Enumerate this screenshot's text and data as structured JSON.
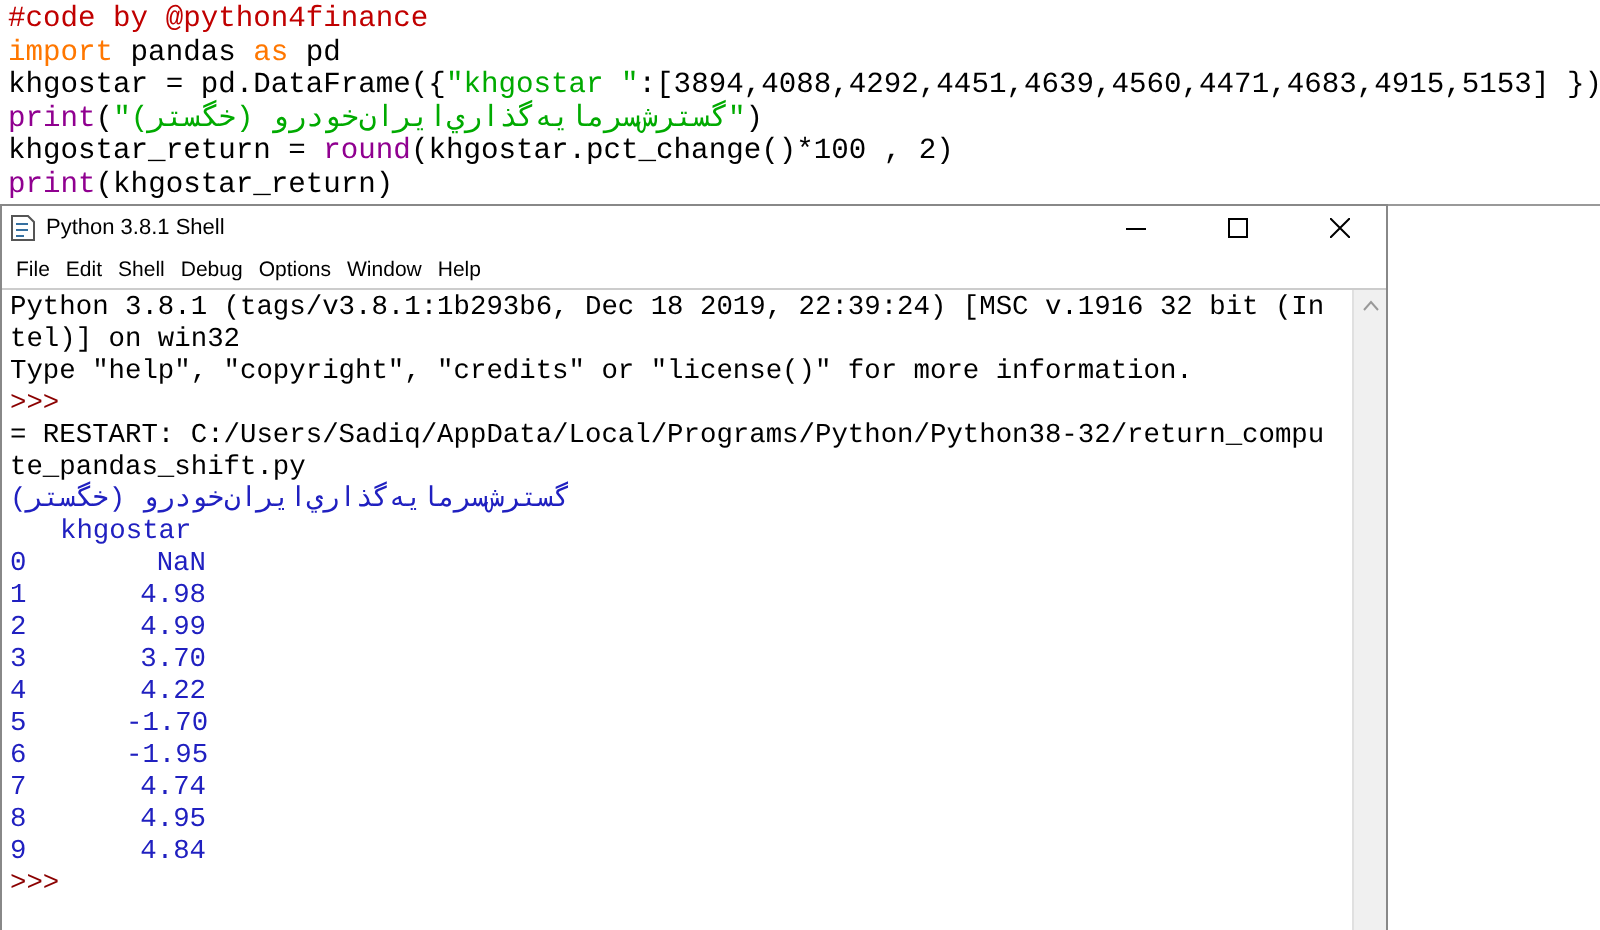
{
  "editor": {
    "lines": [
      [
        {
          "kind": "comment",
          "text": "#code by @python4finance"
        }
      ],
      [
        {
          "kind": "keyword",
          "text": "import"
        },
        {
          "kind": "plain",
          "text": " pandas "
        },
        {
          "kind": "keyword",
          "text": "as"
        },
        {
          "kind": "plain",
          "text": " pd"
        }
      ],
      [
        {
          "kind": "plain",
          "text": "khgostar = pd.DataFrame({"
        },
        {
          "kind": "string",
          "text": "\"khgostar \""
        },
        {
          "kind": "plain",
          "text": ":[3894,4088,4292,4451,4639,4560,4471,4683,4915,5153] })"
        }
      ],
      [
        {
          "kind": "builtin",
          "text": "print"
        },
        {
          "kind": "plain",
          "text": "("
        },
        {
          "kind": "string",
          "text": "\"گسترش‌سرمایه‌گذاري‌ايران‌خودرو (خگستر)\""
        },
        {
          "kind": "plain",
          "text": ")"
        }
      ],
      [
        {
          "kind": "plain",
          "text": "khgostar_return = "
        },
        {
          "kind": "builtin",
          "text": "round"
        },
        {
          "kind": "plain",
          "text": "(khgostar.pct_change()*100 , 2)"
        }
      ],
      [
        {
          "kind": "builtin",
          "text": "print"
        },
        {
          "kind": "plain",
          "text": "(khgostar_return)"
        }
      ]
    ]
  },
  "shell": {
    "title": "Python 3.8.1 Shell",
    "menu": [
      "File",
      "Edit",
      "Shell",
      "Debug",
      "Options",
      "Window",
      "Help"
    ],
    "lines": [
      {
        "kind": "text",
        "text": "Python 3.8.1 (tags/v3.8.1:1b293b6, Dec 18 2019, 22:39:24) [MSC v.1916 32 bit (In"
      },
      {
        "kind": "text",
        "text": "tel)] on win32"
      },
      {
        "kind": "text",
        "text": "Type \"help\", \"copyright\", \"credits\" or \"license()\" for more information."
      },
      {
        "kind": "prompt",
        "text": ">>>"
      },
      {
        "kind": "text",
        "text": "= RESTART: C:/Users/Sadiq/AppData/Local/Programs/Python/Python38-32/return_compu"
      },
      {
        "kind": "text",
        "text": "te_pandas_shift.py"
      },
      {
        "kind": "output",
        "text": "گسترش‌سرمایه‌گذاري‌ايران‌خودرو (خگستر)"
      }
    ],
    "table": {
      "column": "khgostar",
      "rows": [
        {
          "index": "0",
          "value": "NaN"
        },
        {
          "index": "1",
          "value": "4.98"
        },
        {
          "index": "2",
          "value": "4.99"
        },
        {
          "index": "3",
          "value": "3.70"
        },
        {
          "index": "4",
          "value": "4.22"
        },
        {
          "index": "5",
          "value": "-1.70"
        },
        {
          "index": "6",
          "value": "-1.95"
        },
        {
          "index": "7",
          "value": "4.74"
        },
        {
          "index": "8",
          "value": "4.95"
        },
        {
          "index": "9",
          "value": "4.84"
        }
      ]
    },
    "final_prompt": ">>>"
  }
}
